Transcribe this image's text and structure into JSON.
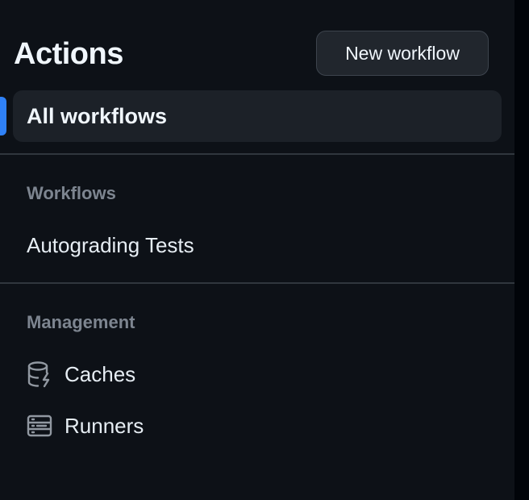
{
  "header": {
    "title": "Actions",
    "new_workflow_label": "New workflow"
  },
  "nav": {
    "all_workflows_label": "All workflows",
    "workflows_heading": "Workflows",
    "workflows": [
      {
        "label": "Autograding Tests"
      }
    ],
    "management_heading": "Management",
    "management": [
      {
        "label": "Caches",
        "icon": "database-icon"
      },
      {
        "label": "Runners",
        "icon": "server-icon"
      }
    ]
  },
  "colors": {
    "background": "#0d1117",
    "accent": "#2f81f7",
    "selected_bg": "#1c2128",
    "muted_text": "#7d8590"
  }
}
